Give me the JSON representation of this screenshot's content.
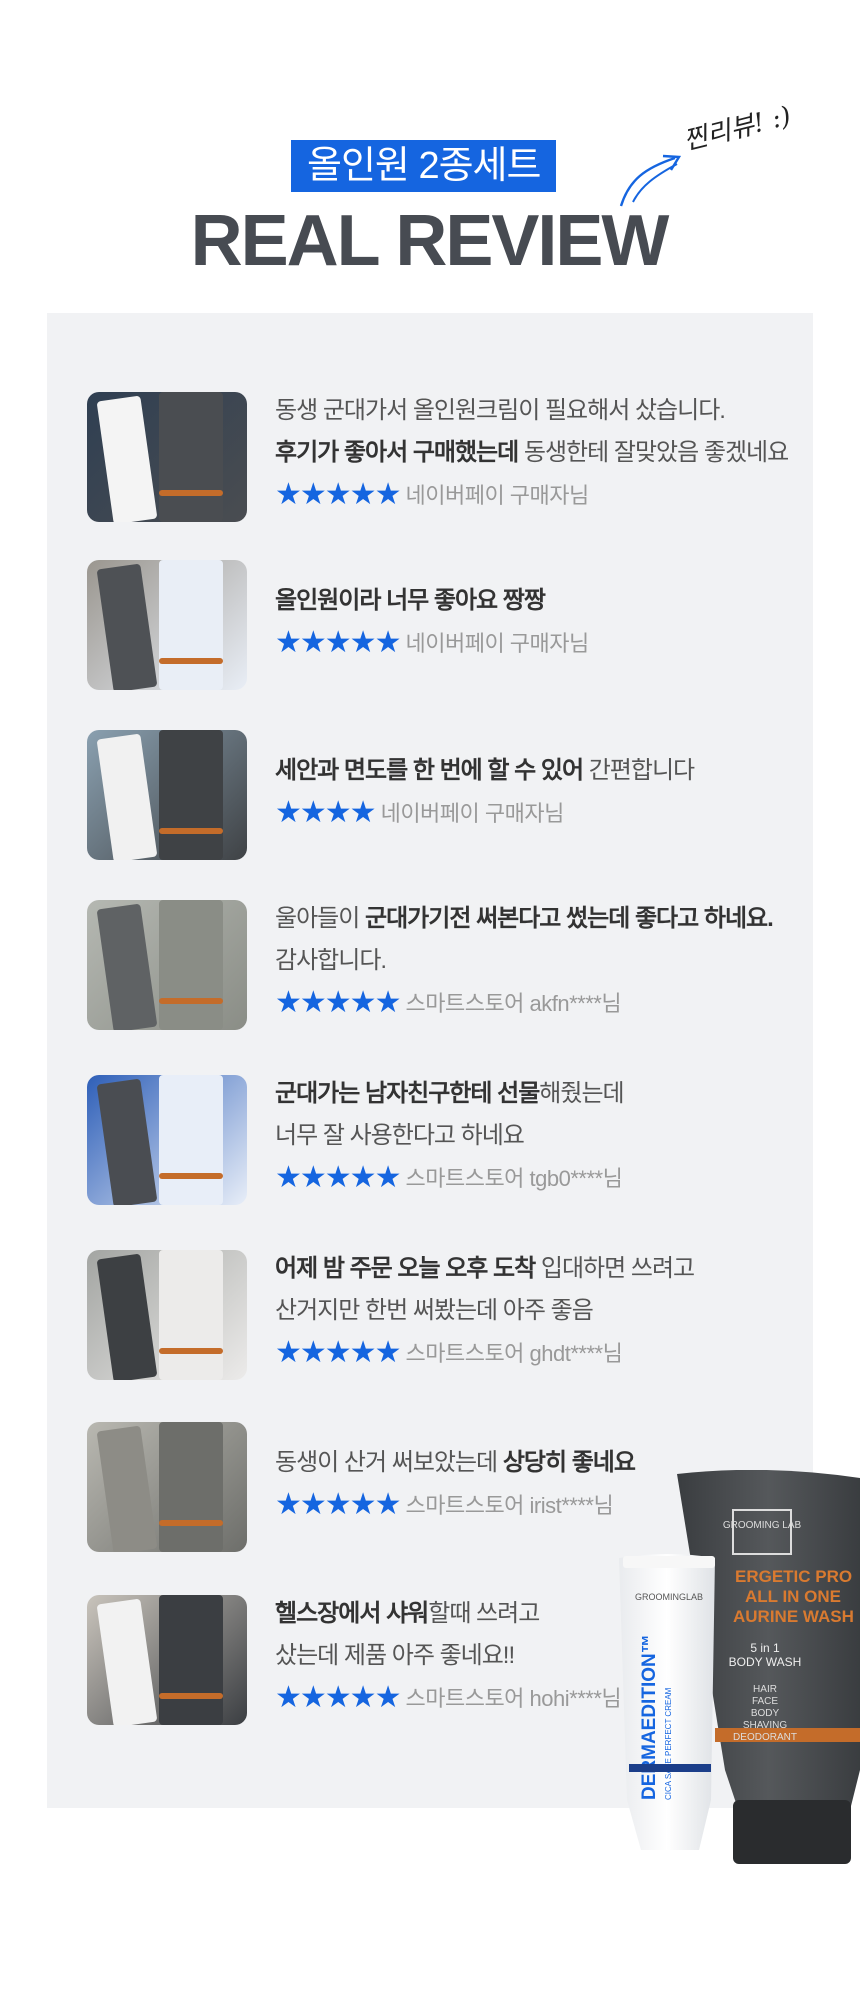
{
  "header": {
    "tag": "올인원 2종세트",
    "title": "REAL REVIEW",
    "handwritten": "찐리뷰! :)"
  },
  "reviews": [
    {
      "lines": [
        [
          {
            "t": "동생 군대가서 올인원크림이 필요해서 샀습니다.",
            "b": false
          }
        ],
        [
          {
            "t": "후기가 좋아서 구매했는데",
            "b": true
          },
          {
            "t": " 동생한테 잘맞았음 좋겠네요",
            "b": false
          }
        ]
      ],
      "stars": "★★★★★",
      "source": "네이버페이 구매자님"
    },
    {
      "lines": [
        [
          {
            "t": "올인원이라 너무 좋아요 짱짱",
            "b": true
          }
        ]
      ],
      "stars": "★★★★★",
      "source": "네이버페이 구매자님"
    },
    {
      "lines": [
        [
          {
            "t": "세안과 면도를  한 번에 할 수 있어",
            "b": true
          },
          {
            "t": " 간편합니다",
            "b": false
          }
        ]
      ],
      "stars": "★★★★",
      "source": "네이버페이 구매자님"
    },
    {
      "lines": [
        [
          {
            "t": "울아들이 ",
            "b": false
          },
          {
            "t": "군대가기전 써본다고 썼는데 좋다고 하네요.",
            "b": true
          }
        ],
        [
          {
            "t": "감사합니다.",
            "b": false
          }
        ]
      ],
      "stars": "★★★★★",
      "source": "스마트스토어  akfn****님"
    },
    {
      "lines": [
        [
          {
            "t": "군대가는 남자친구한테 선물",
            "b": true
          },
          {
            "t": "해줬는데",
            "b": false
          }
        ],
        [
          {
            "t": "너무 잘 사용한다고 하네요",
            "b": false
          }
        ]
      ],
      "stars": "★★★★★",
      "source": "스마트스토어 tgb0****님"
    },
    {
      "lines": [
        [
          {
            "t": "어제 밤 주문 오늘 오후 도착",
            "b": true
          },
          {
            "t": " 입대하면 쓰려고",
            "b": false
          }
        ],
        [
          {
            "t": "산거지만 한번 써봤는데 아주 좋음",
            "b": false
          }
        ]
      ],
      "stars": "★★★★★",
      "source": "스마트스토어  ghdt****님"
    },
    {
      "lines": [
        [
          {
            "t": "동생이 산거 써보았는데 ",
            "b": false
          },
          {
            "t": "상당히 좋네요",
            "b": true
          }
        ]
      ],
      "stars": "★★★★★",
      "source": "스마트스토어 irist****님"
    },
    {
      "lines": [
        [
          {
            "t": "헬스장에서 샤워",
            "b": true
          },
          {
            "t": "할때 쓰려고",
            "b": false
          }
        ],
        [
          {
            "t": "샀는데 제품 아주 좋네요!!",
            "b": false
          }
        ]
      ],
      "stars": "★★★★★",
      "source": "스마트스토어 hohi****님"
    }
  ],
  "product": {
    "tube_dark": {
      "brand": "GROOMING LAB",
      "name_lines": [
        "ERGETIC PRO",
        "ALL IN ONE",
        "AURINE WASH"
      ],
      "sub_lines": [
        "5 in 1",
        "BODY WASH"
      ],
      "uses": [
        "HAIR",
        "FACE",
        "BODY",
        "SHAVING",
        "DEODORANT"
      ]
    },
    "tube_white": {
      "brand": "GROOMINGLAB",
      "vertical": "DERMAEDITION™",
      "vertical_sub": "CICA SAFE PERFECT CREAM"
    }
  },
  "colors": {
    "accent": "#1565e0",
    "title": "#474b52",
    "panel": "#f1f2f4"
  }
}
